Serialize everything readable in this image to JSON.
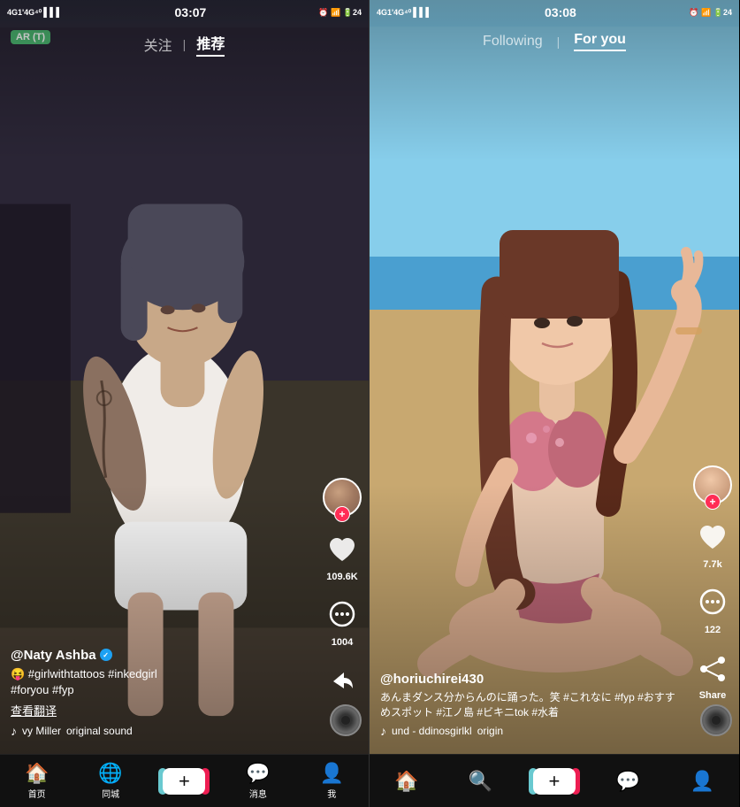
{
  "left_panel": {
    "status_bar": {
      "time": "03:07",
      "network": "4G1'4G",
      "signal": "▌▌▌",
      "battery": "24"
    },
    "nav": {
      "ar_label": "AR (T)",
      "following": "关注",
      "divider": "|",
      "for_you": "推荐",
      "active": "for_you"
    },
    "actions": {
      "like_count": "109.6K",
      "comment_count": "1004",
      "share_label": ""
    },
    "video_info": {
      "username": "@Naty Ashba",
      "verified": true,
      "caption": "😝 #girlwithtattoos #inkedgirl\n#foryou #fyp",
      "translate": "查看翻译",
      "music_artist": "vy Miller",
      "music_title": "original sound"
    },
    "bottom_nav": [
      {
        "icon": "🏠",
        "label": "首页",
        "active": true
      },
      {
        "icon": "🌐",
        "label": "同城",
        "active": false
      },
      {
        "icon": "+",
        "label": "",
        "active": false
      },
      {
        "icon": "💬",
        "label": "消息",
        "active": false
      },
      {
        "icon": "👤",
        "label": "我",
        "active": false
      }
    ]
  },
  "right_panel": {
    "status_bar": {
      "time": "03:08",
      "network": "4G1'4G",
      "battery": "24"
    },
    "nav": {
      "following": "Following",
      "divider": "|",
      "for_you": "For you",
      "active": "for_you"
    },
    "actions": {
      "like_count": "7.7k",
      "comment_count": "122",
      "share_label": "Share"
    },
    "video_info": {
      "username": "@horiuchirei430",
      "verified": false,
      "caption": "あんまダンス分からんのに踊った。笑 #これなに #fyp #おすすめスポット #江ノ島  #ビキニtok #水着",
      "music_title": "origin",
      "music_artist": "und - ddinosgirlkl"
    },
    "bottom_nav": [
      {
        "icon": "🏠",
        "label": "",
        "active": true
      },
      {
        "icon": "🔍",
        "label": "",
        "active": false
      },
      {
        "icon": "+",
        "label": "",
        "active": false
      },
      {
        "icon": "💬",
        "label": "",
        "active": false
      },
      {
        "icon": "👤",
        "label": "",
        "active": false
      }
    ]
  }
}
